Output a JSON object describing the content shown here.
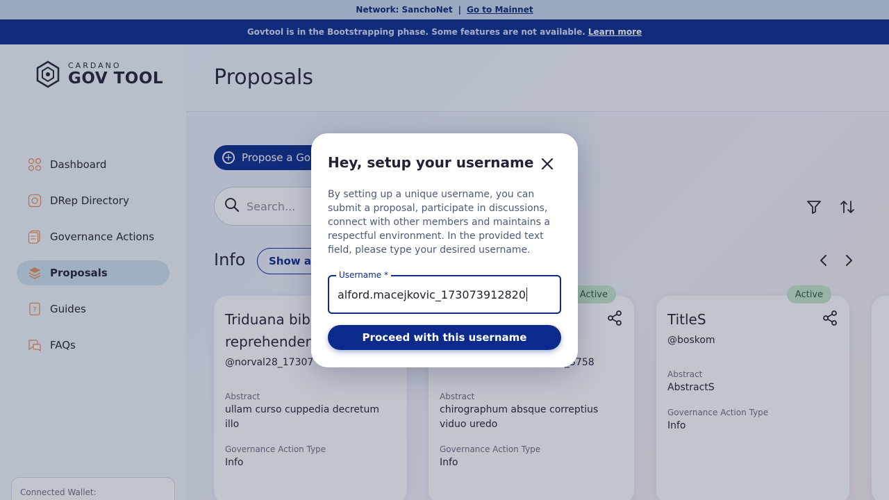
{
  "network_banner": {
    "text": "Network: SanchoNet",
    "separator": "|",
    "link": "Go to Mainnet"
  },
  "phase_banner": {
    "text": "Govtool is in the Bootstrapping phase. Some features are not available.",
    "link": "Learn more"
  },
  "logo": {
    "sub": "CARDANO",
    "main": "GOV TOOL"
  },
  "sidebar": {
    "items": [
      {
        "label": "Dashboard",
        "icon": "dashboard-icon",
        "active": false
      },
      {
        "label": "DRep Directory",
        "icon": "drep-icon",
        "active": false
      },
      {
        "label": "Governance Actions",
        "icon": "governance-icon",
        "active": false
      },
      {
        "label": "Proposals",
        "icon": "proposals-icon",
        "active": true
      },
      {
        "label": "Guides",
        "icon": "guides-icon",
        "active": false
      },
      {
        "label": "FAQs",
        "icon": "faqs-icon",
        "active": false
      }
    ],
    "wallet_label": "Connected Wallet:"
  },
  "main": {
    "title": "Proposals",
    "propose_label": "Propose a Go",
    "search_placeholder": "Search...",
    "section_title": "Info",
    "show_all_label": "Show all"
  },
  "cards": [
    {
      "title": "Triduana bib reprehenderi",
      "user": "@norval28_17307",
      "abstract_label": "Abstract",
      "abstract": "ullam curso cuppedia decretum illo",
      "type_label": "Governance Action Type",
      "type": "Info",
      "badge": ""
    },
    {
      "title": "",
      "user": "_3758",
      "abstract_label": "Abstract",
      "abstract": "chirographum absque correptius viduo uredo",
      "type_label": "Governance Action Type",
      "type": "Info",
      "badge": "Active"
    },
    {
      "title": "TitleS",
      "user": "@boskom",
      "abstract_label": "Abstract",
      "abstract": "AbstractS",
      "type_label": "Governance Action Type",
      "type": "Info",
      "badge": "Active"
    }
  ],
  "modal": {
    "title": "Hey, setup your username",
    "description": "By setting up a unique username, you can submit a proposal, participate in discussions, connect with other members and maintains a respectful environment. In the provided text field, please type your desired username.",
    "field_label": "Username *",
    "field_value": "alford.macejkovic_173073912820",
    "proceed_label": "Proceed with this username"
  },
  "colors": {
    "primary": "#0b2a8c",
    "active_nav": "#cfe3ee",
    "badge": "#c7e8c9",
    "icon_orange": "#e8915a"
  }
}
